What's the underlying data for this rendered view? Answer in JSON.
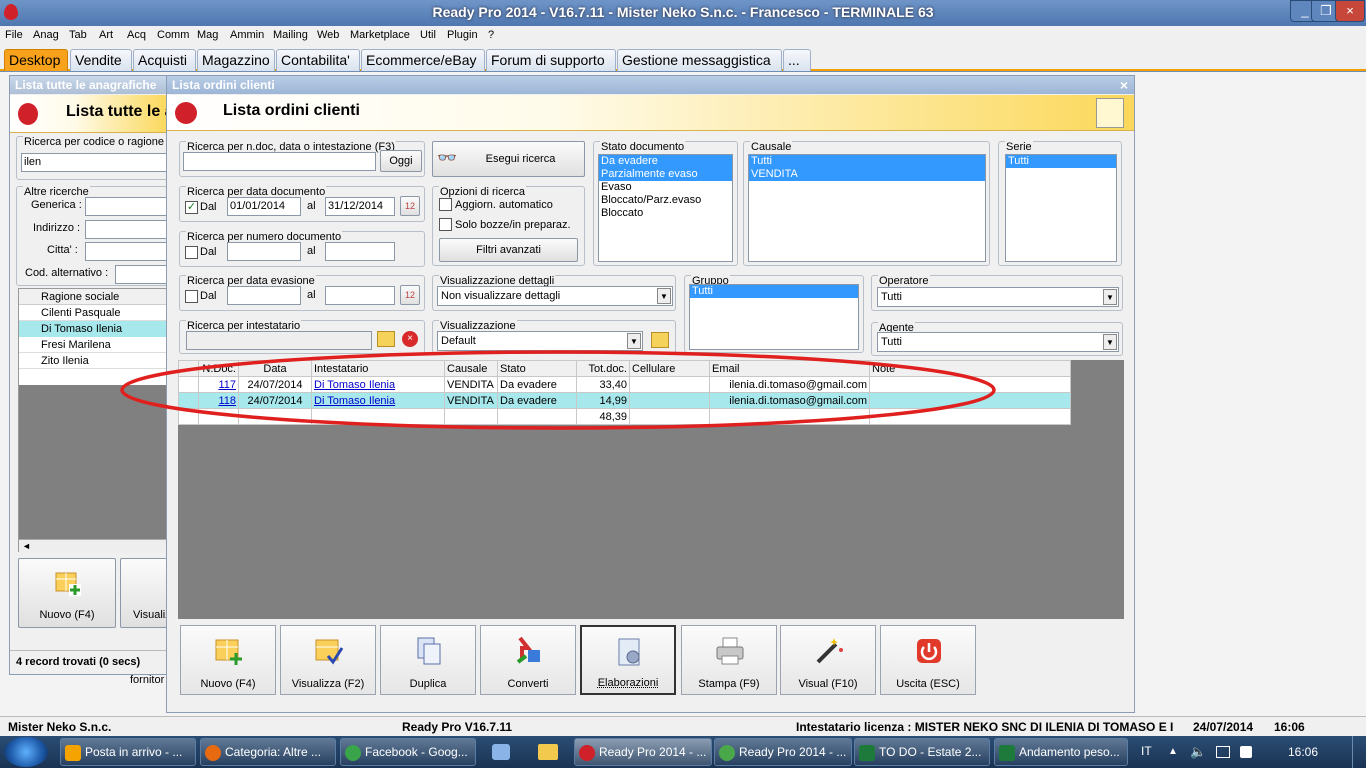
{
  "app": {
    "title": "Ready Pro 2014 - V16.7.11 - Mister Neko S.n.c. - Francesco - TERMINALE 63"
  },
  "menu": [
    "File",
    "Anag",
    "Tab",
    "Art",
    "Acq",
    "Comm",
    "Mag",
    "Ammin",
    "Mailing",
    "Web",
    "Marketplace",
    "Util",
    "Plugin",
    "?"
  ],
  "tabs": [
    "Desktop",
    "Vendite",
    "Acquisti",
    "Magazzino",
    "Contabilita'",
    "Ecommerce/eBay",
    "Forum di supporto",
    "Gestione messaggistica",
    "..."
  ],
  "back_window": {
    "title": "Lista tutte le anagrafiche",
    "heading": "Lista tutte le a",
    "search_label": "Ricerca per codice o ragione s",
    "search_value": "ilen",
    "other_label": "Altre ricerche",
    "fields": [
      "Generica :",
      "Indirizzo :",
      "Citta' :",
      "Cod. alternativo :"
    ],
    "col_header": "Ragione sociale",
    "rows": [
      "Cilenti Pasquale",
      "Di Tomaso Ilenia",
      "Fresi Marilena",
      "Zito Ilenia"
    ],
    "btn_new": "Nuovo (F4)",
    "btn_view": "Visualiz",
    "status": "4 record trovati (0 secs)",
    "side_text": "fornitor"
  },
  "window": {
    "title": "Lista ordini clienti",
    "heading": "Lista ordini clienti",
    "close": "×"
  },
  "search": {
    "group1_label": "Ricerca per n.doc, data o intestazione (F3)",
    "oggi": "Oggi",
    "esegui": "Esegui ricerca",
    "date_label": "Ricerca per data documento",
    "dal": "Dal",
    "al": "al",
    "date_from": "01/01/2014",
    "date_to": "31/12/2014",
    "num_label": "Ricerca per numero documento",
    "evas_label": "Ricerca per data evasione",
    "intest_label": "Ricerca per intestatario",
    "options_label": "Opzioni di ricerca",
    "opt1": "Aggiorn. automatico",
    "opt2": "Solo bozze/in preparaz.",
    "filtri": "Filtri avanzati",
    "vis_det_label": "Visualizzazione dettagli",
    "vis_det_value": "Non visualizzare dettagli",
    "vis_label": "Visualizzazione",
    "vis_value": "Default"
  },
  "stato": {
    "label": "Stato documento",
    "items": [
      "Da evadere",
      "Parzialmente evaso",
      "Evaso",
      "Bloccato/Parz.evaso",
      "Bloccato"
    ]
  },
  "causale": {
    "label": "Causale",
    "items": [
      "Tutti",
      "VENDITA"
    ]
  },
  "serie": {
    "label": "Serie",
    "items": [
      "Tutti"
    ]
  },
  "gruppo": {
    "label": "Gruppo",
    "items": [
      "Tutti"
    ]
  },
  "operatore": {
    "label": "Operatore",
    "value": "Tutti"
  },
  "agente": {
    "label": "Agente",
    "value": "Tutti"
  },
  "table": {
    "headers": [
      "N.Doc.",
      "Data",
      "Intestatario",
      "Causale",
      "Stato",
      "Tot.doc.",
      "Cellulare",
      "Email",
      "Note"
    ],
    "rows": [
      {
        "ndoc": "117",
        "data": "24/07/2014",
        "intest": "Di Tomaso Ilenia",
        "causale": "VENDITA",
        "stato": "Da evadere",
        "tot": "33,40",
        "cell": "",
        "email": "ilenia.di.tomaso@gmail.com",
        "note": ""
      },
      {
        "ndoc": "118",
        "data": "24/07/2014",
        "intest": "Di Tomaso Ilenia",
        "causale": "VENDITA",
        "stato": "Da evadere",
        "tot": "14,99",
        "cell": "",
        "email": "ilenia.di.tomaso@gmail.com",
        "note": ""
      }
    ],
    "total": "48,39"
  },
  "buttons": [
    "Nuovo (F4)",
    "Visualizza (F2)",
    "Duplica",
    "Converti",
    "Elaborazioni",
    "Stampa (F9)",
    "Visual (F10)",
    "Uscita (ESC)"
  ],
  "statusbar": {
    "left": "Mister Neko S.n.c.",
    "mid": "Ready Pro V16.7.11",
    "lic": "Intestatario licenza : MISTER NEKO SNC DI ILENIA DI TOMASO E I",
    "date": "24/07/2014",
    "time": "16:06"
  },
  "taskbar": {
    "items": [
      "Posta in arrivo - ...",
      "Categoria: Altre ...",
      "Facebook - Goog...",
      "Ready Pro 2014 - ...",
      "Ready Pro 2014 - ...",
      "TO DO - Estate 2...",
      "Andamento peso..."
    ],
    "lang": "IT",
    "clock": "16:06"
  },
  "colors": {
    "accent": "#f7a21a",
    "highlight": "#a7e8ec",
    "annotation": "#e0201f"
  }
}
